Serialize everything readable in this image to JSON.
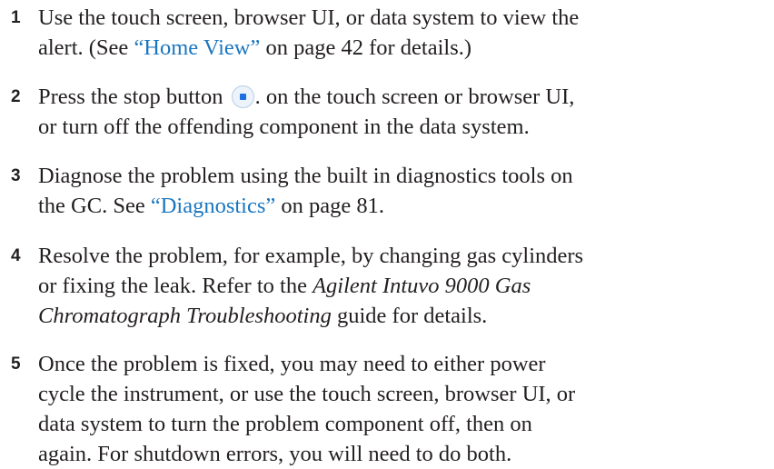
{
  "steps": [
    {
      "number": "1",
      "lines": [
        "Use the touch screen, browser UI, or data system to view the",
        "alert. (See ",
        "“Home View”",
        " on page 42 for details.)"
      ]
    },
    {
      "number": "2",
      "lines": [
        "Press the stop button ",
        ". on the touch screen or browser UI,",
        "or turn off the offending component in the data system."
      ],
      "icon": "stop-button-icon"
    },
    {
      "number": "3",
      "lines": [
        "Diagnose the problem using the built in diagnostics tools on",
        "the GC. See ",
        "“Diagnostics”",
        " on page 81."
      ]
    },
    {
      "number": "4",
      "lines": [
        "Resolve the problem, for example, by changing gas cylinders",
        "or fixing the leak. Refer to the ",
        "Agilent Intuvo 9000 Gas",
        "Chromatograph Troubleshooting",
        " guide for details."
      ]
    },
    {
      "number": "5",
      "lines": [
        "Once the problem is fixed, you may need to either power",
        "cycle the instrument, or use the touch screen, browser UI, or",
        "data system to turn the problem component off, then on",
        "again. For shutdown errors, you will need to do both."
      ]
    }
  ],
  "colors": {
    "text": "#231f20",
    "link": "#1a76bf",
    "stop_icon": "#1e6fe0"
  }
}
